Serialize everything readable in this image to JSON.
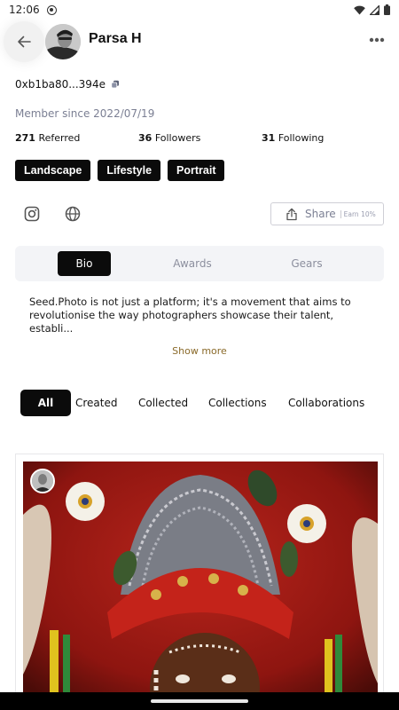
{
  "status_bar": {
    "time": "12:06",
    "icons": [
      "notification-icon",
      "wifi-icon",
      "signal-icon",
      "battery-icon"
    ]
  },
  "header": {
    "name": "Parsa H",
    "back_icon": "arrow-left-icon",
    "more_icon": "more-horizontal-icon"
  },
  "profile": {
    "wallet": "0xb1ba80...394e",
    "member_since": "Member since 2022/07/19",
    "stats": [
      {
        "count": "271",
        "label": "Referred"
      },
      {
        "count": "36",
        "label": "Followers"
      },
      {
        "count": "31",
        "label": "Following"
      }
    ],
    "tags": [
      "Landscape",
      "Lifestyle",
      "Portrait"
    ],
    "social_icons": [
      "instagram-icon",
      "globe-icon"
    ]
  },
  "share": {
    "label": "Share",
    "sub": "Earn 10%"
  },
  "profile_tabs": {
    "items": [
      "Bio",
      "Awards",
      "Gears"
    ],
    "active": "Bio"
  },
  "bio": {
    "text": "Seed.Photo is not just a platform; it's a movement that aims to revolutionise the way photographers showcase their talent, establi...",
    "show_more": "Show more"
  },
  "filter_tabs": {
    "items": [
      "All",
      "Created",
      "Collected",
      "Collections",
      "Collaborations"
    ],
    "active": "All"
  },
  "colors": {
    "accent": "#0b0b0b",
    "muted_text": "#7b7f93",
    "show_more": "#8a6a2a",
    "tab_bg": "#f3f4f7"
  }
}
